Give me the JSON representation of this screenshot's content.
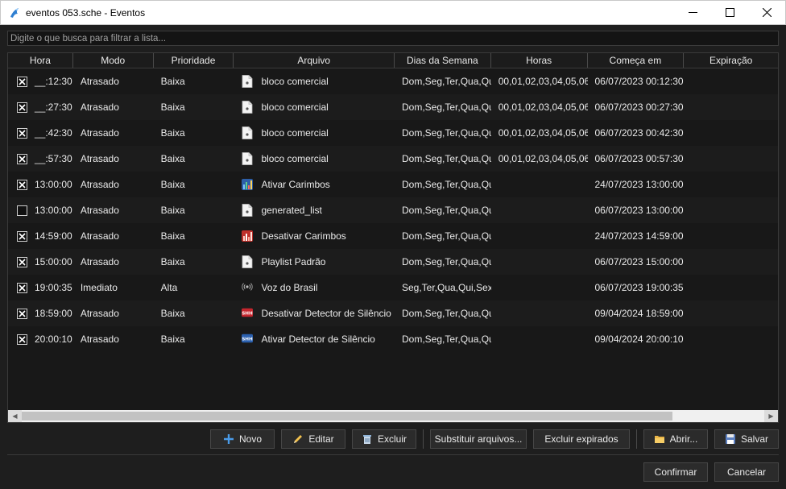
{
  "window": {
    "title": "eventos 053.sche - Eventos"
  },
  "search": {
    "placeholder": "Digite o que busca para filtrar a lista..."
  },
  "columns": [
    "Hora",
    "Modo",
    "Prioridade",
    "Arquivo",
    "Dias da Semana",
    "Horas",
    "Começa em",
    "Expiração"
  ],
  "rows": [
    {
      "checked": true,
      "hora": "__:12:30",
      "modo": "Atrasado",
      "prioridade": "Baixa",
      "icon": "document-icon",
      "arquivo": "bloco comercial",
      "dias": "Dom,Seg,Ter,Qua,Qu",
      "horas": "00,01,02,03,04,05,06,",
      "comeca": "06/07/2023 00:12:30",
      "expiracao": ""
    },
    {
      "checked": true,
      "hora": "__:27:30",
      "modo": "Atrasado",
      "prioridade": "Baixa",
      "icon": "document-icon",
      "arquivo": "bloco comercial",
      "dias": "Dom,Seg,Ter,Qua,Qu",
      "horas": "00,01,02,03,04,05,06,",
      "comeca": "06/07/2023 00:27:30",
      "expiracao": ""
    },
    {
      "checked": true,
      "hora": "__:42:30",
      "modo": "Atrasado",
      "prioridade": "Baixa",
      "icon": "document-icon",
      "arquivo": "bloco comercial",
      "dias": "Dom,Seg,Ter,Qua,Qu",
      "horas": "00,01,02,03,04,05,06,",
      "comeca": "06/07/2023 00:42:30",
      "expiracao": ""
    },
    {
      "checked": true,
      "hora": "__:57:30",
      "modo": "Atrasado",
      "prioridade": "Baixa",
      "icon": "document-icon",
      "arquivo": "bloco comercial",
      "dias": "Dom,Seg,Ter,Qua,Qu",
      "horas": "00,01,02,03,04,05,06,",
      "comeca": "06/07/2023 00:57:30",
      "expiracao": ""
    },
    {
      "checked": true,
      "hora": "13:00:00",
      "modo": "Atrasado",
      "prioridade": "Baixa",
      "icon": "chart-blue-icon",
      "arquivo": "Ativar Carimbos",
      "dias": "Dom,Seg,Ter,Qua,Qu",
      "horas": "",
      "comeca": "24/07/2023 13:00:00",
      "expiracao": ""
    },
    {
      "checked": false,
      "hora": "13:00:00",
      "modo": "Atrasado",
      "prioridade": "Baixa",
      "icon": "document-icon",
      "arquivo": "generated_list",
      "dias": "Dom,Seg,Ter,Qua,Qu",
      "horas": "",
      "comeca": "06/07/2023 13:00:00",
      "expiracao": ""
    },
    {
      "checked": true,
      "hora": "14:59:00",
      "modo": "Atrasado",
      "prioridade": "Baixa",
      "icon": "chart-red-icon",
      "arquivo": "Desativar Carimbos",
      "dias": "Dom,Seg,Ter,Qua,Qu",
      "horas": "",
      "comeca": "24/07/2023 14:59:00",
      "expiracao": ""
    },
    {
      "checked": true,
      "hora": "15:00:00",
      "modo": "Atrasado",
      "prioridade": "Baixa",
      "icon": "document-icon",
      "arquivo": "Playlist Padrão",
      "dias": "Dom,Seg,Ter,Qua,Qu",
      "horas": "",
      "comeca": "06/07/2023 15:00:00",
      "expiracao": ""
    },
    {
      "checked": true,
      "hora": "19:00:35",
      "modo": "Imediato",
      "prioridade": "Alta",
      "icon": "broadcast-icon",
      "arquivo": "Voz do Brasil",
      "dias": "Seg,Ter,Qua,Qui,Sex",
      "horas": "",
      "comeca": "06/07/2023 19:00:35",
      "expiracao": ""
    },
    {
      "checked": true,
      "hora": "18:59:00",
      "modo": "Atrasado",
      "prioridade": "Baixa",
      "icon": "silence-red-icon",
      "arquivo": "Desativar Detector de Silêncio",
      "dias": "Dom,Seg,Ter,Qua,Qu",
      "horas": "",
      "comeca": "09/04/2024 18:59:00",
      "expiracao": ""
    },
    {
      "checked": true,
      "hora": "20:00:10",
      "modo": "Atrasado",
      "prioridade": "Baixa",
      "icon": "silence-blue-icon",
      "arquivo": "Ativar Detector de Silêncio",
      "dias": "Dom,Seg,Ter,Qua,Qu",
      "horas": "",
      "comeca": "09/04/2024 20:00:10",
      "expiracao": ""
    }
  ],
  "toolbar": {
    "novo": "Novo",
    "editar": "Editar",
    "excluir": "Excluir",
    "substituir": "Substituir arquivos...",
    "excluir_expirados": "Excluir expirados",
    "abrir": "Abrir...",
    "salvar": "Salvar"
  },
  "footer": {
    "confirmar": "Confirmar",
    "cancelar": "Cancelar"
  },
  "colors": {
    "background": "#1e1e1e",
    "grid": "#181818",
    "accent_blue": "#3b8de0"
  }
}
